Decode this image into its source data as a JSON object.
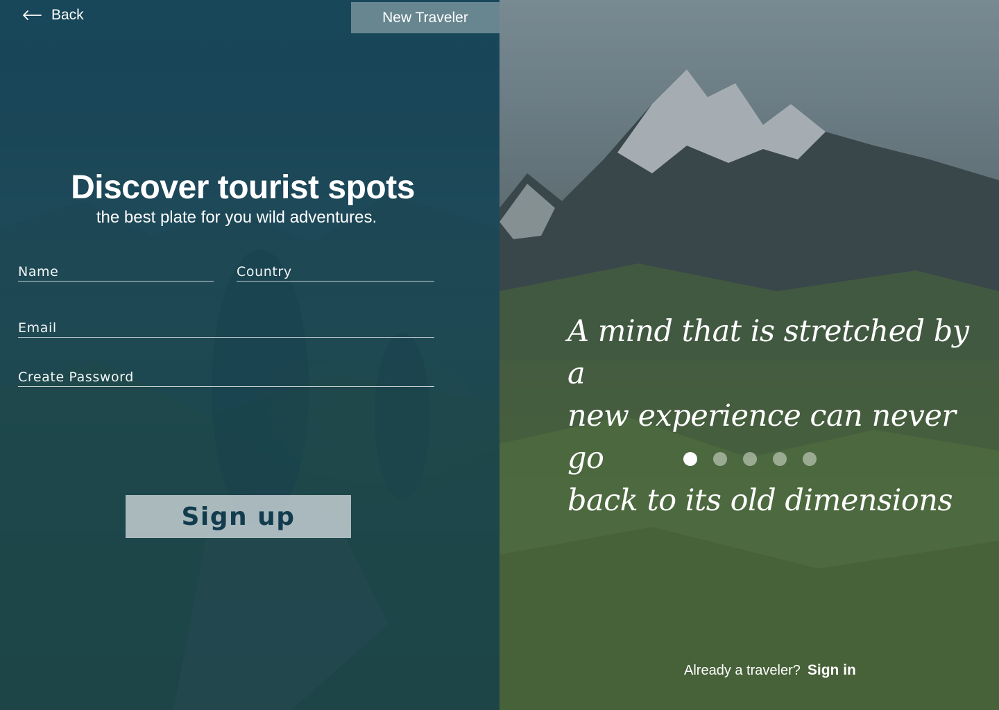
{
  "header": {
    "back_label": "Back",
    "new_traveler_label": "New Traveler"
  },
  "signup_form": {
    "title": "Discover tourist spots",
    "subtitle": "the best plate for you wild adventures.",
    "fields": {
      "name_placeholder": "Name",
      "country_placeholder": "Country",
      "email_placeholder": "Email",
      "password_placeholder": "Create Password"
    },
    "submit_label": "Sign up"
  },
  "carousel": {
    "quote_lines": [
      "A mind that is stretched by a",
      "new experience can never go",
      "back to its old dimensions"
    ],
    "slide_count": 5,
    "active_index": 0
  },
  "footer": {
    "prompt": "Already a traveler?",
    "signin_label": "Sign in"
  },
  "colors": {
    "overlay": "#124054",
    "button_text": "#123c4e",
    "button_bg": "#c8d2d6"
  },
  "icons": {
    "back": "arrow-left-icon"
  }
}
